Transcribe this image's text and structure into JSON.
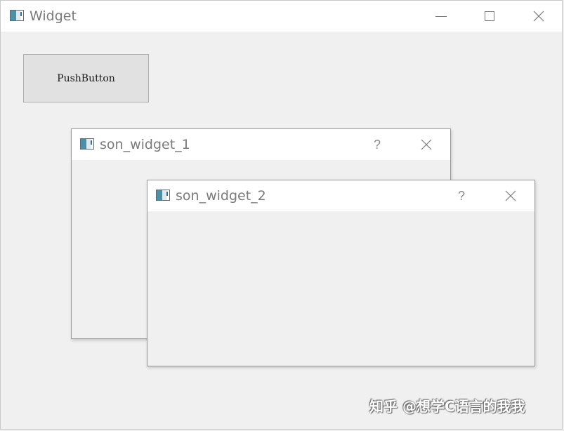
{
  "main_window": {
    "title": "Widget",
    "icon": "app-window-icon",
    "controls": [
      "minimize-icon",
      "maximize-icon",
      "close-icon"
    ]
  },
  "push_button": {
    "label": "PushButton"
  },
  "son_widget_1": {
    "title": "son_widget_1",
    "icon": "app-window-icon",
    "help_label": "?",
    "controls": [
      "help-icon",
      "close-icon"
    ]
  },
  "son_widget_2": {
    "title": "son_widget_2",
    "icon": "app-window-icon",
    "help_label": "?",
    "controls": [
      "help-icon",
      "close-icon"
    ]
  },
  "watermark": {
    "text": "知乎 @想学C语言的我我"
  }
}
